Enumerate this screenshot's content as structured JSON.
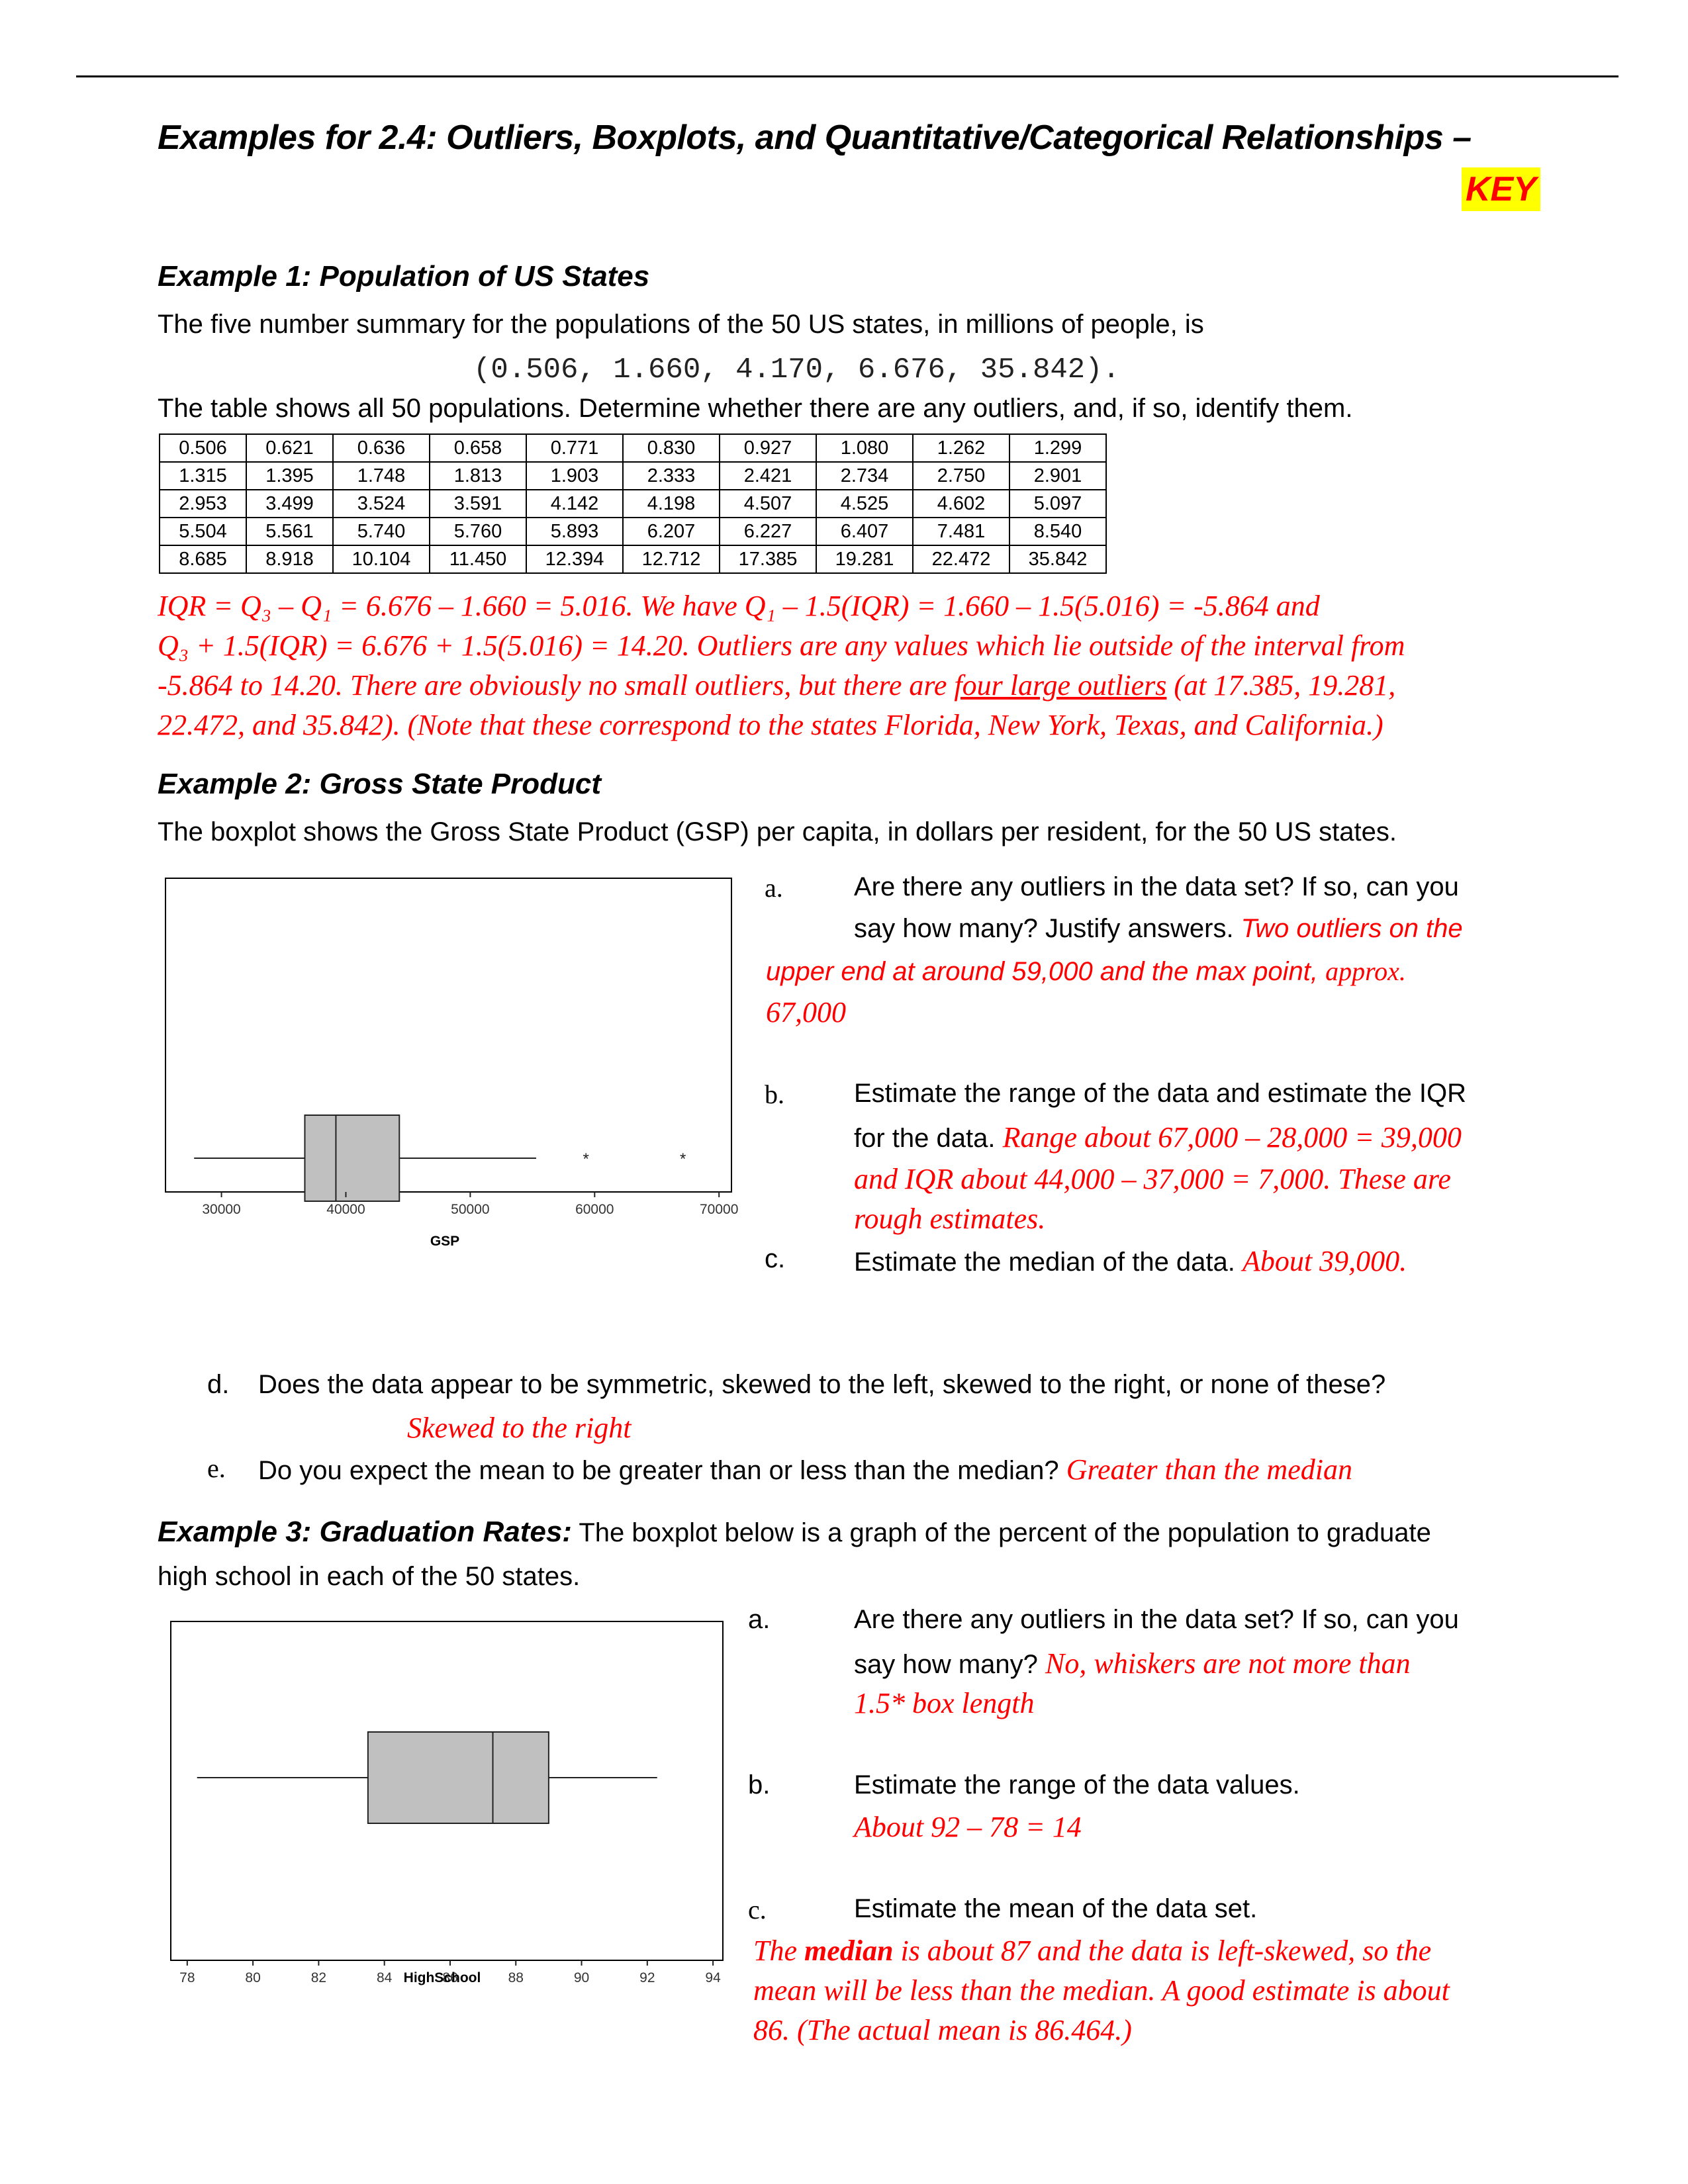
{
  "document": {
    "title": "Examples for 2.4:  Outliers, Boxplots, and Quantitative/Categorical Relationships –",
    "key_label": "KEY"
  },
  "example1": {
    "heading": "Example 1:  Population of US States",
    "intro": "The five number summary for the populations of the 50 US states, in millions of people, is",
    "five_number_summary": "(0.506, 1.660, 4.170, 6.676, 35.842).",
    "instruction": "The table shows all 50 populations.  Determine whether there are any outliers, and, if so, identify them.",
    "table": [
      [
        "0.506",
        "0.621",
        "0.636",
        "0.658",
        "0.771",
        "0.830",
        "0.927",
        "1.080",
        "1.262",
        "1.299"
      ],
      [
        "1.315",
        "1.395",
        "1.748",
        "1.813",
        "1.903",
        "2.333",
        "2.421",
        "2.734",
        "2.750",
        "2.901"
      ],
      [
        "2.953",
        "3.499",
        "3.524",
        "3.591",
        "4.142",
        "4.198",
        "4.507",
        "4.525",
        "4.602",
        "5.097"
      ],
      [
        "5.504",
        "5.561",
        "5.740",
        "5.760",
        "5.893",
        "6.207",
        "6.227",
        "6.407",
        "7.481",
        "8.540"
      ],
      [
        "8.685",
        "8.918",
        "10.104",
        "11.450",
        "12.394",
        "12.712",
        "17.385",
        "19.281",
        "22.472",
        "35.842"
      ]
    ],
    "answer_line1": "IQR = Q₃ – Q₁ = 6.676 – 1.660 = 5.016.  We have Q₁ – 1.5(IQR) = 1.660 – 1.5(5.016) = -5.864 and",
    "answer_line2": "Q₃ + 1.5(IQR) = 6.676 + 1.5(5.016) = 14.20.  Outliers are any values which lie outside of the interval from",
    "answer_line3_pre": "-5.864 to 14.20.  There are obviously no small outliers, but there are ",
    "answer_line3_underlined": "four large outliers",
    "answer_line3_post": " (at 17.385, 19.281,",
    "answer_line4": "22.472, and 35.842). (Note that these correspond to the states Florida, New York, Texas, and California.)"
  },
  "example2": {
    "heading": "Example 2:  Gross State Product",
    "intro": "The boxplot shows the Gross State Product (GSP) per capita, in dollars per resident, for the 50 US states.",
    "qa": {
      "label": "a.",
      "line1": "Are there any outliers in the data set? If so, can you",
      "line2_q": "say how many?  Justify answers.  ",
      "line2_a": "Two outliers on the",
      "line3_a": "upper end at around 59,000 and the max point, ",
      "line3_b": "approx.",
      "line4_a": "67,000"
    },
    "qb": {
      "label": "b.",
      "line1": "Estimate the range of the data and estimate the IQR",
      "line2_q": "for the data.  ",
      "line2_a": "Range about 67,000 – 28,000 = 39,000",
      "line3_a": "and  IQR about 44,000 – 37,000 = 7,000.  These are",
      "line4_a": " rough estimates."
    },
    "qc": {
      "label": "c.",
      "question": "Estimate the median of the data.  ",
      "answer": "About 39,000."
    },
    "qd": {
      "label": "d.",
      "question": "Does the data appear to be symmetric, skewed to the left, skewed to the right, or none of these?",
      "answer": "Skewed to the right"
    },
    "qe": {
      "label": "e.",
      "question": "Do you expect the mean to be greater than or less than the median?  ",
      "answer": "Greater than the median"
    }
  },
  "example3": {
    "heading": "Example 3:  Graduation Rates:",
    "intro_line1": " The boxplot below is a graph of the percent of the population to graduate",
    "intro_line2": "high school in each of the 50 states.",
    "qa": {
      "label": "a.",
      "line1": "Are there any outliers in the data set? If so, can you",
      "line2_q": "say how many?  ",
      "line2_a": "No, whiskers are not more than",
      "line3_a": "1.5* box length"
    },
    "qb": {
      "label": "b.",
      "question": "Estimate the range of the data values.",
      "answer": "About 92 – 78 = 14"
    },
    "qc": {
      "label": "c.",
      "question": "Estimate the mean of the data set.",
      "answer_pre": "The ",
      "answer_bold": "median",
      "answer_line1_post": " is about 87 and the data is left-skewed, so the",
      "answer_line2": "mean will be less than the median.  A good estimate is about",
      "answer_line3": "86. (The  actual mean is 86.464.)"
    }
  },
  "colors": {
    "answer_red": "#ff0000",
    "key_highlight": "#ffff00",
    "box_fill": "#c0c0c0"
  },
  "chart_data": [
    {
      "type": "boxplot",
      "orientation": "horizontal",
      "xlabel": "GSP",
      "ticks": [
        30000,
        40000,
        50000,
        60000,
        70000
      ],
      "tick_labels": [
        "30000",
        "40000",
        "50000",
        "60000",
        "70000"
      ],
      "xlim": [
        25500,
        71000
      ],
      "whisker_low": 27800,
      "q1": 36700,
      "median": 39200,
      "q3": 44300,
      "whisker_high": 55300,
      "outliers": [
        59300,
        67100
      ],
      "outlier_marker": "*"
    },
    {
      "type": "boxplot",
      "orientation": "horizontal",
      "xlabel": "HighSchool",
      "ticks": [
        78,
        80,
        82,
        84,
        86,
        88,
        90,
        92,
        94
      ],
      "tick_labels": [
        "78",
        "80",
        "82",
        "84",
        "86",
        "88",
        "90",
        "92",
        "94"
      ],
      "xlim": [
        77.5,
        94.3
      ],
      "whisker_low": 78.3,
      "q1": 83.5,
      "median": 87.3,
      "q3": 89.0,
      "whisker_high": 92.3,
      "outliers": []
    }
  ]
}
